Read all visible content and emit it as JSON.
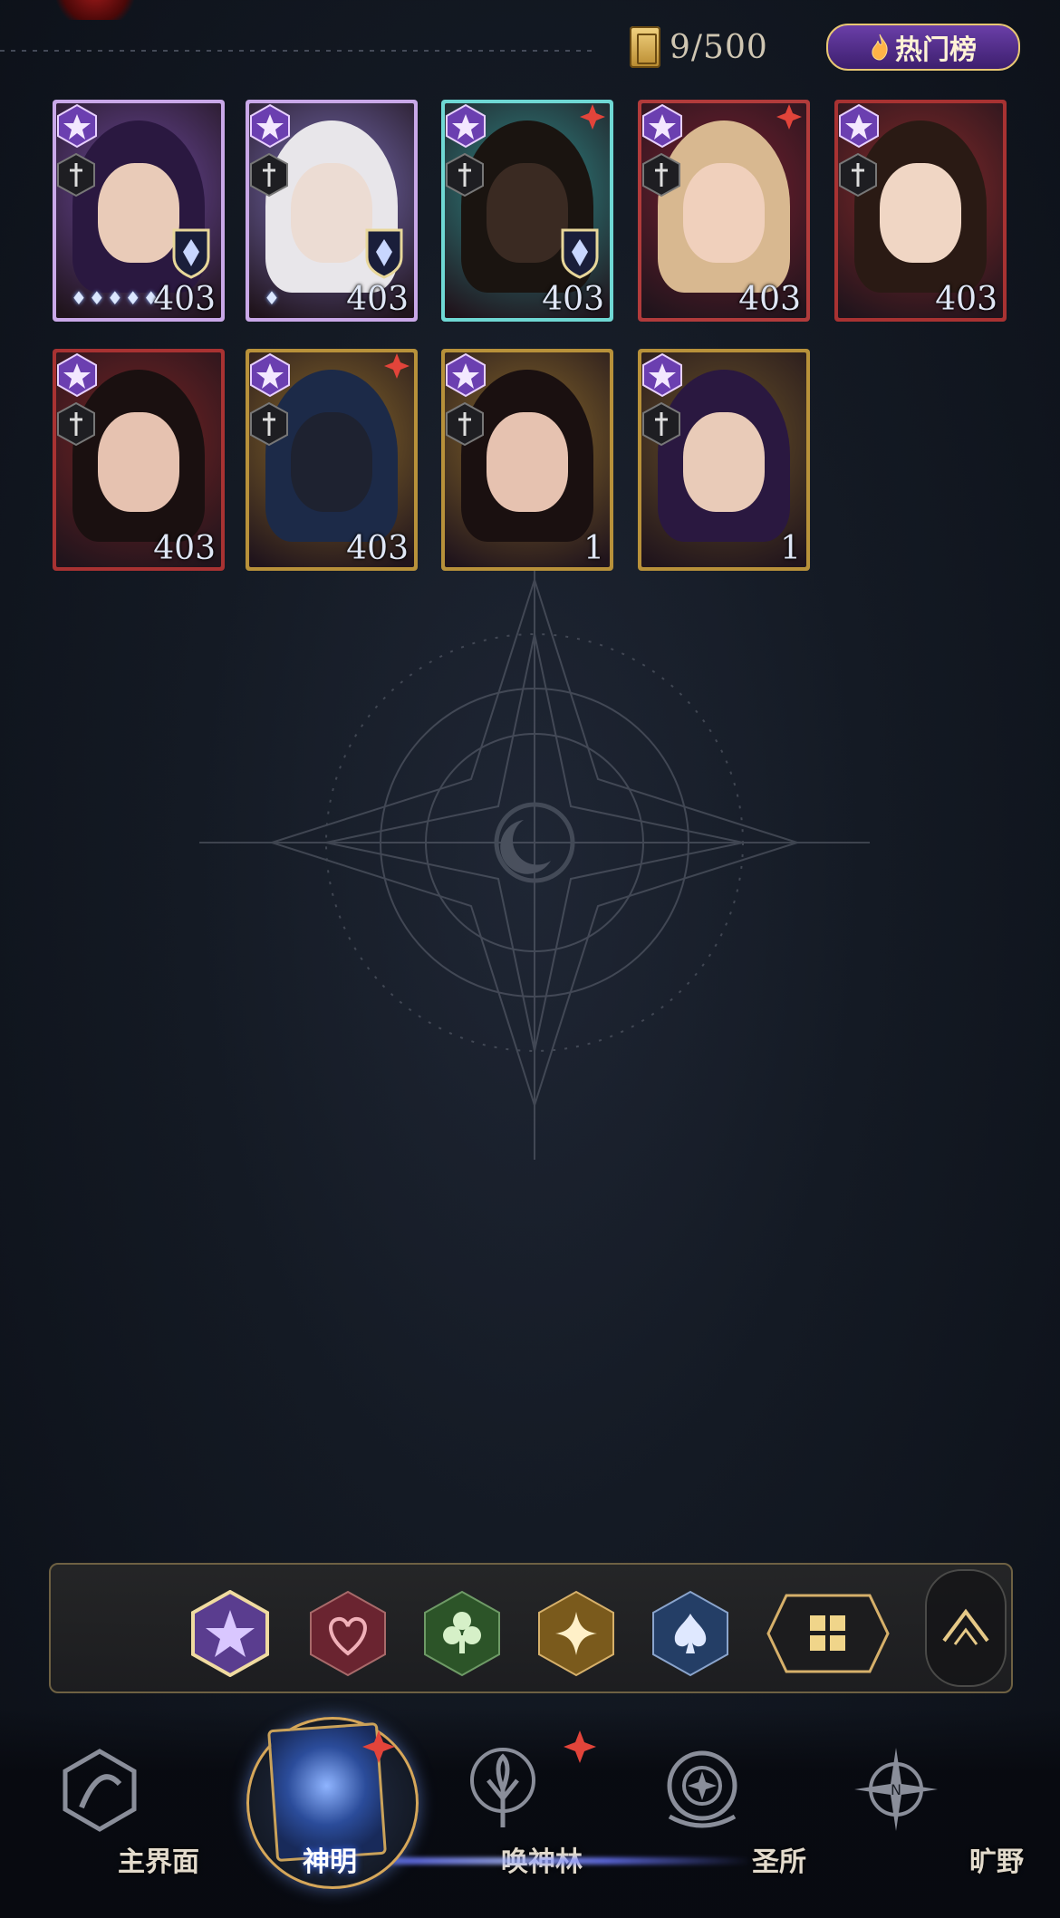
{
  "header": {
    "card_count": "9/500",
    "hot_ranking_label": "热门榜"
  },
  "cards": [
    {
      "level": "403",
      "frame": "#c9a8e8",
      "bg": "#6e4aa0",
      "suit": "star",
      "element": "ice",
      "stars": "♦♦♦♦♦",
      "new": false
    },
    {
      "level": "403",
      "frame": "#c9a8e8",
      "bg": "#7a6fb8",
      "suit": "star",
      "element": "ice",
      "stars": "♦",
      "new": false
    },
    {
      "level": "403",
      "frame": "#6fd8d4",
      "bg": "#2f8f8c",
      "suit": "star",
      "element": "shield",
      "stars": "",
      "new": true
    },
    {
      "level": "403",
      "frame": "#b13b3b",
      "bg": "#7a2030",
      "suit": "star",
      "element": "",
      "stars": "",
      "new": true
    },
    {
      "level": "403",
      "frame": "#a83232",
      "bg": "#8a2a2a",
      "suit": "star",
      "element": "",
      "stars": "",
      "new": false
    },
    {
      "level": "403",
      "frame": "#a83232",
      "bg": "#7a2424",
      "suit": "star",
      "element": "",
      "stars": "",
      "new": false
    },
    {
      "level": "403",
      "frame": "#b8913a",
      "bg": "#8a6a2a",
      "suit": "star",
      "element": "",
      "stars": "",
      "new": true
    },
    {
      "level": "1",
      "frame": "#b8913a",
      "bg": "#8a6a2a",
      "suit": "star",
      "element": "",
      "stars": "",
      "new": false
    },
    {
      "level": "1",
      "frame": "#b8913a",
      "bg": "#6a5228",
      "suit": "star",
      "element": "",
      "stars": "",
      "new": false
    }
  ],
  "filters": [
    {
      "name": "star-filter",
      "color": "#6b4aa8",
      "selected": true
    },
    {
      "name": "heart-filter",
      "color": "#7a2a34",
      "selected": false
    },
    {
      "name": "club-filter",
      "color": "#2f5a2c",
      "selected": false
    },
    {
      "name": "diamond-filter",
      "color": "#8a6a22",
      "selected": false
    },
    {
      "name": "spade-filter",
      "color": "#2a4a7a",
      "selected": false
    }
  ],
  "nav": {
    "main_world": "主界面",
    "gods": "神明",
    "summon_forest": "唤神林",
    "sanctuary": "圣所",
    "wilderness": "旷野"
  },
  "colors": {
    "accent_gold": "#d6b06a",
    "alert_red": "#e2443a",
    "hot_purple": "#5a2f92"
  }
}
